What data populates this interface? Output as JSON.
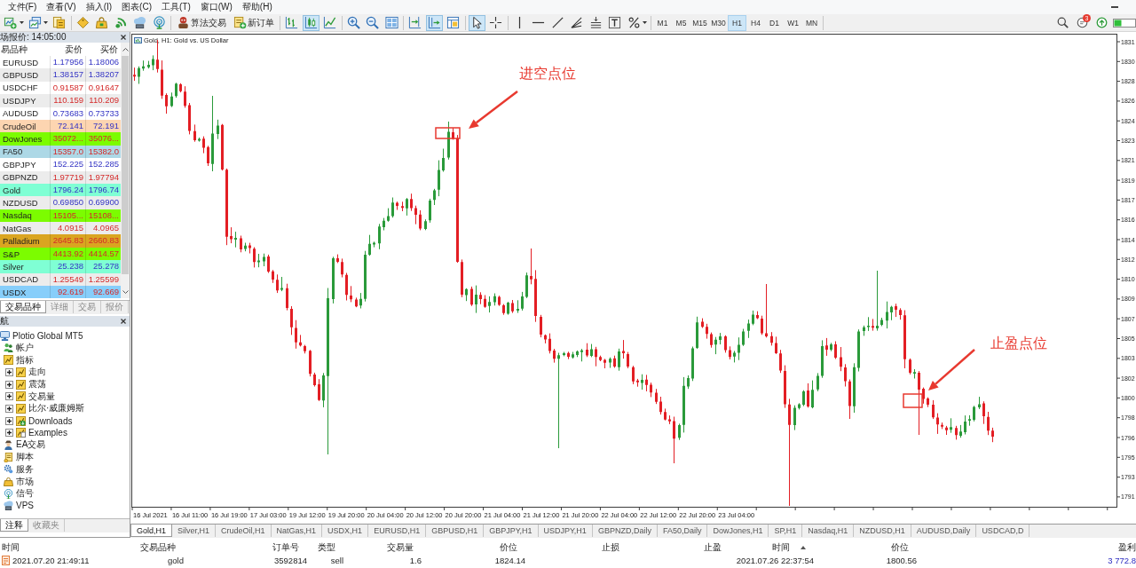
{
  "menu": [
    "文件(F)",
    "查看(V)",
    "插入(I)",
    "图表(C)",
    "工具(T)",
    "窗口(W)",
    "帮助(H)"
  ],
  "toolbar": {
    "groups": [
      [
        {
          "selected": false,
          "dropdown": true
        },
        {
          "selected": false,
          "dropdown": true
        },
        {
          "selected": false
        }
      ],
      [
        {
          "selected": false
        },
        {
          "selected": false
        },
        {
          "selected": false
        },
        {
          "selected": false
        },
        {
          "selected": false
        }
      ],
      [
        {
          "label": "算法交易",
          "selected": false
        },
        {
          "label": "新订单",
          "selected": false
        }
      ],
      [
        {
          "selected": false
        },
        {
          "selected": true
        },
        {
          "selected": false
        }
      ],
      [
        {
          "selected": false
        },
        {
          "selected": false
        },
        {
          "selected": false
        }
      ],
      [
        {
          "selected": false
        },
        {
          "selected": true
        },
        {
          "selected": false
        }
      ],
      [
        {
          "selected": true
        },
        {
          "selected": false
        }
      ],
      [
        {
          "selected": false
        },
        {
          "selected": false
        },
        {
          "selected": false
        },
        {
          "selected": false
        },
        {
          "selected": false
        },
        {
          "selected": false
        },
        {
          "selected": false,
          "dropdown": true
        }
      ]
    ],
    "timeframes": [
      {
        "label": "M1",
        "selected": false
      },
      {
        "label": "M5",
        "selected": false
      },
      {
        "label": "M15",
        "selected": false
      },
      {
        "label": "M30",
        "selected": false
      },
      {
        "label": "H1",
        "selected": true
      },
      {
        "label": "H4",
        "selected": false
      },
      {
        "label": "D1",
        "selected": false
      },
      {
        "label": "W1",
        "selected": false
      },
      {
        "label": "MN",
        "selected": false
      }
    ],
    "notification_count": "3"
  },
  "market_watch": {
    "title": "场报价: 14:05:00",
    "columns": [
      "易品种",
      "卖价",
      "买价"
    ],
    "rows": [
      {
        "symbol": "EURUSD",
        "bid": "1.17956",
        "ask": "1.18006",
        "color": "#ffffff",
        "rising": true
      },
      {
        "symbol": "GBPUSD",
        "bid": "1.38157",
        "ask": "1.38207",
        "color": "#ececec",
        "rising": true
      },
      {
        "symbol": "USDCHF",
        "bid": "0.91587",
        "ask": "0.91647",
        "color": "#ffffff",
        "rising": false
      },
      {
        "symbol": "USDJPY",
        "bid": "110.159",
        "ask": "110.209",
        "color": "#ececec",
        "rising": false
      },
      {
        "symbol": "AUDUSD",
        "bid": "0.73683",
        "ask": "0.73733",
        "color": "#ffffff",
        "rising": true
      },
      {
        "symbol": "CrudeOil",
        "bid": "72.141",
        "ask": "72.191",
        "color": "#fdd5b1",
        "rising": true
      },
      {
        "symbol": "DowJones",
        "bid": "35072...",
        "ask": "35076...",
        "color": "#7cfc00",
        "rising": false
      },
      {
        "symbol": "FA50",
        "bid": "15357.0",
        "ask": "15382.0",
        "color": "#add8e6",
        "rising": false
      },
      {
        "symbol": "GBPJPY",
        "bid": "152.225",
        "ask": "152.285",
        "color": "#ffffff",
        "rising": true
      },
      {
        "symbol": "GBPNZD",
        "bid": "1.97719",
        "ask": "1.97794",
        "color": "#ececec",
        "rising": false
      },
      {
        "symbol": "Gold",
        "bid": "1796.24",
        "ask": "1796.74",
        "color": "#7fffd4",
        "rising": true
      },
      {
        "symbol": "NZDUSD",
        "bid": "0.69850",
        "ask": "0.69900",
        "color": "#ececec",
        "rising": true
      },
      {
        "symbol": "Nasdaq",
        "bid": "15105...",
        "ask": "15108...",
        "color": "#7cfc00",
        "rising": false
      },
      {
        "symbol": "NatGas",
        "bid": "4.0915",
        "ask": "4.0965",
        "color": "#ececec",
        "rising": false
      },
      {
        "symbol": "Palladium",
        "bid": "2645.83",
        "ask": "2660.83",
        "color": "#daa520",
        "rising": false
      },
      {
        "symbol": "S&P",
        "bid": "4413.92",
        "ask": "4414.57",
        "color": "#7cfc00",
        "rising": false
      },
      {
        "symbol": "Silver",
        "bid": "25.238",
        "ask": "25.278",
        "color": "#7fffd4",
        "rising": true
      },
      {
        "symbol": "USDCAD",
        "bid": "1.25549",
        "ask": "1.25599",
        "color": "#ececec",
        "rising": false
      },
      {
        "symbol": "USDX",
        "bid": "92.619",
        "ask": "92.669",
        "color": "#87cefa",
        "rising": false
      }
    ],
    "tabs": [
      {
        "label": "交易品种",
        "selected": true
      },
      {
        "label": "详细",
        "selected": false
      },
      {
        "label": "交易",
        "selected": false
      },
      {
        "label": "报价",
        "selected": false
      }
    ]
  },
  "navigator": {
    "title": "航",
    "tree": [
      {
        "label": "Plotio Global MT5",
        "kind": "server",
        "children": [
          {
            "label": "帐户",
            "kind": "accounts"
          },
          {
            "label": "指标",
            "kind": "indicators",
            "children": [
              {
                "label": "走向",
                "kind": "indicator-folder",
                "expanded": false
              },
              {
                "label": "震荡",
                "kind": "indicator-folder",
                "expanded": false
              },
              {
                "label": "交易量",
                "kind": "indicator-folder",
                "expanded": false
              },
              {
                "label": "比尔·威廉姆斯",
                "kind": "indicator-folder",
                "expanded": false
              },
              {
                "label": "Downloads",
                "kind": "download-folder",
                "expanded": false
              },
              {
                "label": "Examples",
                "kind": "example-folder",
                "expanded": false
              }
            ]
          },
          {
            "label": "EA交易",
            "kind": "experts"
          },
          {
            "label": "脚本",
            "kind": "scripts"
          },
          {
            "label": "服务",
            "kind": "services"
          },
          {
            "label": "市场",
            "kind": "market"
          },
          {
            "label": "信号",
            "kind": "signals"
          },
          {
            "label": "VPS",
            "kind": "vps"
          }
        ]
      }
    ],
    "tabs": [
      {
        "label": "注释",
        "selected": true
      },
      {
        "label": "收藏夹",
        "selected": false
      }
    ]
  },
  "chart": {
    "title": "Gold, H1: Gold vs. US Dollar",
    "price_labels": [
      "1831",
      "1830",
      "1828",
      "1826",
      "1824",
      "1823",
      "1821",
      "1819",
      "1817",
      "1816",
      "1814",
      "1812",
      "1810",
      "1809",
      "1807",
      "1805",
      "1803",
      "1802",
      "1800",
      "1798",
      "1796",
      "1795",
      "1793",
      "1791"
    ],
    "time_labels": [
      "16 Jul 2021",
      "16 Jul 11:00",
      "16 Jul 19:00",
      "17 Jul 03:00",
      "19 Jul 12:00",
      "19 Jul 20:00",
      "20 Jul 04:00",
      "20 Jul 12:00",
      "20 Jul 20:00",
      "21 Jul 04:00",
      "21 Jul 12:00",
      "21 Jul 20:00",
      "22 Jul 04:00",
      "22 Jul 12:00",
      "22 Jul 20:00",
      "23 Jul 04:00"
    ],
    "annotations": [
      {
        "label": "进空点位"
      },
      {
        "label": "止盈点位"
      }
    ],
    "tabs": [
      {
        "label": "Gold,H1",
        "selected": true
      },
      {
        "label": "Silver,H1",
        "selected": false
      },
      {
        "label": "CrudeOil,H1",
        "selected": false
      },
      {
        "label": "NatGas,H1",
        "selected": false
      },
      {
        "label": "USDX,H1",
        "selected": false
      },
      {
        "label": "EURUSD,H1",
        "selected": false
      },
      {
        "label": "GBPUSD,H1",
        "selected": false
      },
      {
        "label": "GBPJPY,H1",
        "selected": false
      },
      {
        "label": "USDJPY,H1",
        "selected": false
      },
      {
        "label": "GBPNZD,Daily",
        "selected": false
      },
      {
        "label": "FA50,Daily",
        "selected": false
      },
      {
        "label": "DowJones,H1",
        "selected": false
      },
      {
        "label": "SP,H1",
        "selected": false
      },
      {
        "label": "Nasdaq,H1",
        "selected": false
      },
      {
        "label": "NZDUSD,H1",
        "selected": false
      },
      {
        "label": "AUDUSD,Daily",
        "selected": false
      },
      {
        "label": "USDCAD,D",
        "selected": false
      }
    ]
  },
  "trade_history": {
    "columns": [
      {
        "label": "时间",
        "sorted": false
      },
      {
        "label": "交易品种",
        "sorted": false
      },
      {
        "label": "订单号",
        "sorted": false
      },
      {
        "label": "类型",
        "sorted": false
      },
      {
        "label": "交易量",
        "sorted": false
      },
      {
        "label": "价位",
        "sorted": false
      },
      {
        "label": "止损",
        "sorted": false
      },
      {
        "label": "止盈",
        "sorted": false
      },
      {
        "label": "时间",
        "sorted": true
      },
      {
        "label": "价位",
        "sorted": false
      },
      {
        "label": "盈利",
        "sorted": false
      }
    ],
    "rows": [
      {
        "open_time": "2021.07.20 21:49:11",
        "symbol": "gold",
        "ticket": "3592814",
        "type": "sell",
        "volume": "1.6",
        "open_price": "1824.14",
        "close_time": "2021.07.26 22:37:54",
        "close_price": "1800.56",
        "profit": "3 772.8"
      }
    ]
  }
}
